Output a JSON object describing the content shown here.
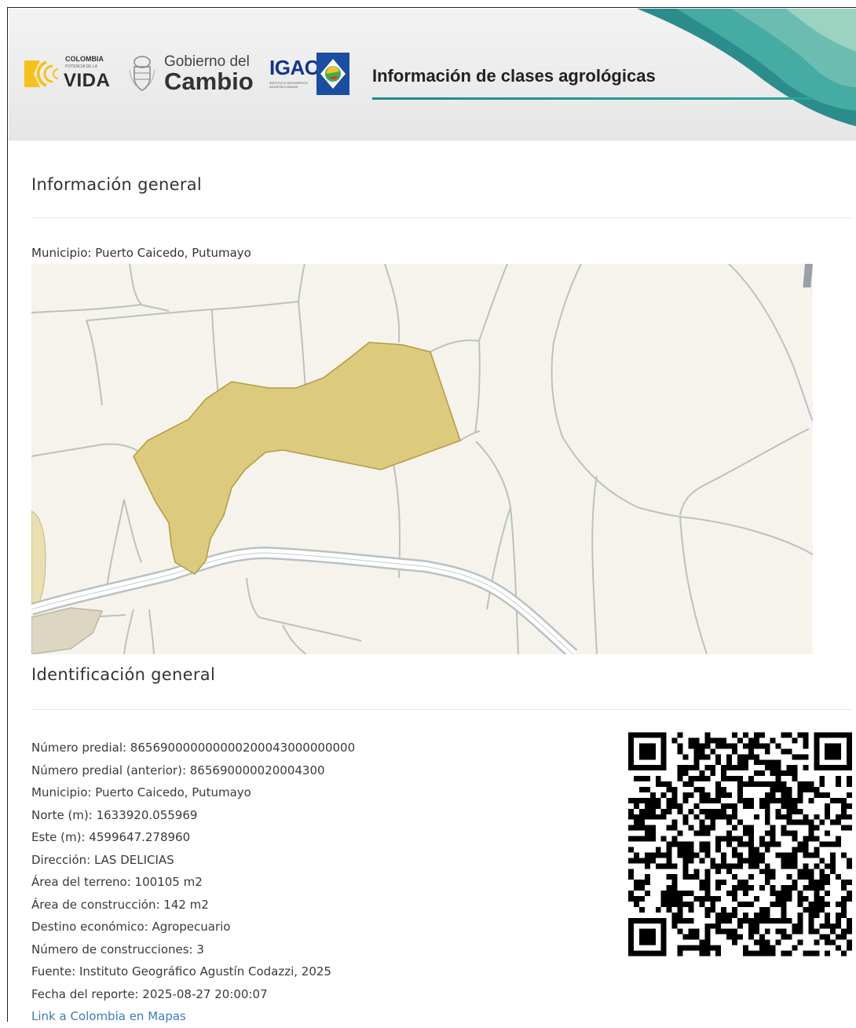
{
  "header": {
    "colombia_top": "COLOMBIA",
    "colombia_sub": "POTENCIA DE LA",
    "colombia_vida": "VIDA",
    "gobierno_line1": "Gobierno del",
    "gobierno_line2": "Cambio",
    "igac": "IGAC",
    "igac_sub": "INSTITUTO GEOGRÁFICO AGUSTÍN CODAZZI",
    "title": "Información de clases agrológicas"
  },
  "general": {
    "title": "Información general",
    "municipio_label": "Municipio: Puerto Caicedo, Putumayo"
  },
  "identificacion": {
    "title": "Identificación general",
    "lines": [
      "Número predial: 865690000000000200043000000000",
      "Número predial (anterior): 865690000020004300",
      "Municipio: Puerto Caicedo, Putumayo",
      "Norte (m): 1633920.055969",
      "Este (m): 4599647.278960",
      "Dirección: LAS DELICIAS",
      "Área del terreno: 100105 m2",
      "Área de construcción: 142 m2",
      "Destino económico: Agropecuario",
      "Número de construcciones: 3",
      "Fuente: Instituto Geográfico Agustín Codazzi, 2025",
      "Fecha del reporte: 2025-08-27 20:00:07"
    ],
    "link": "Link a Colombia en Mapas"
  },
  "colors": {
    "parcel_fill": "#dccb7c",
    "parcel_stroke": "#b49a40",
    "map_bg": "#f6f3ec",
    "boundary": "#b9c2c2",
    "link": "#3a7bc8"
  }
}
